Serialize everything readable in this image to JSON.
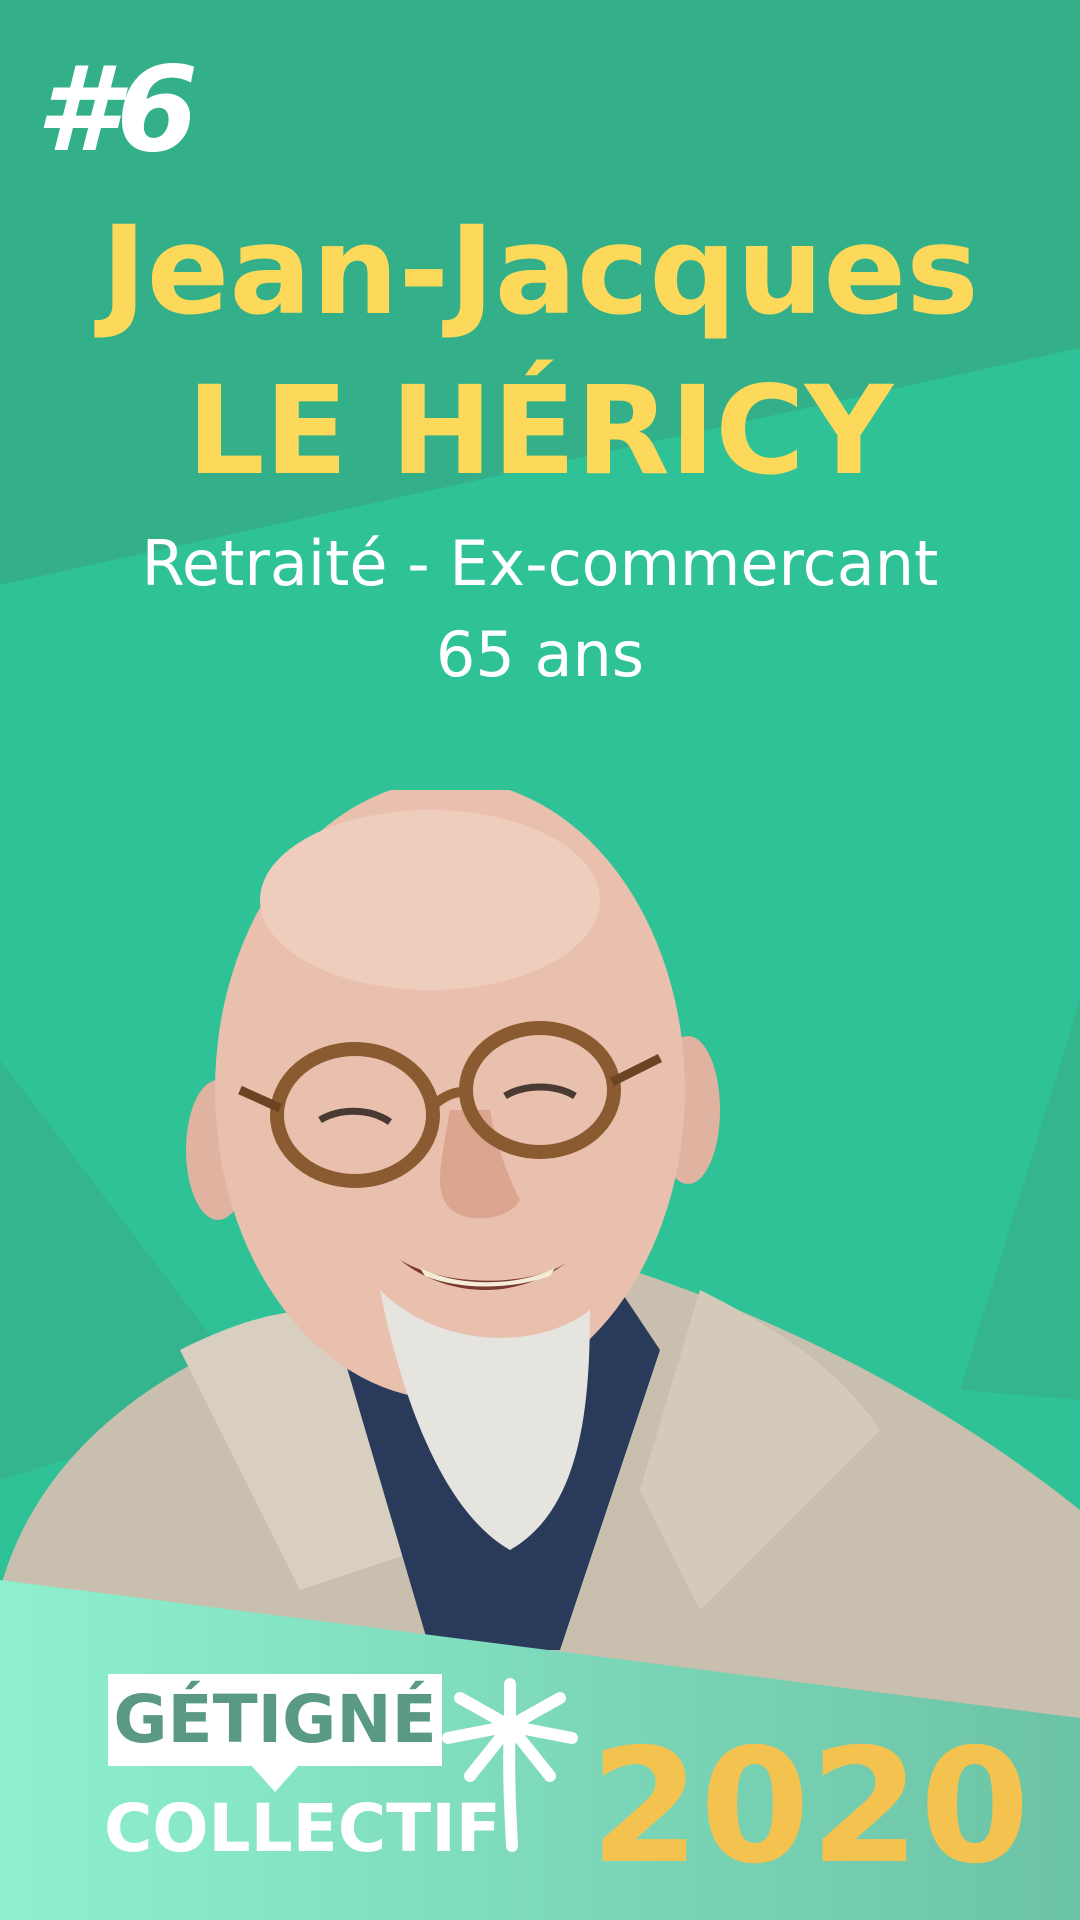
{
  "badge": "#6",
  "candidate": {
    "first_name": "Jean-Jacques",
    "last_name": "LE HÉRICY",
    "profession": "Retraité - Ex-commercant",
    "age": "65 ans"
  },
  "logo": {
    "line1": "GÉTIGNÉ",
    "line2": "COLLECTIF",
    "year": "2020",
    "icon": "palm-tree-icon"
  },
  "colors": {
    "background": "#2fc297",
    "background_dark": "#33b08a",
    "title_yellow": "#fcd95a",
    "year_yellow": "#f3c24f",
    "footer_light": "#8ef0cf"
  }
}
